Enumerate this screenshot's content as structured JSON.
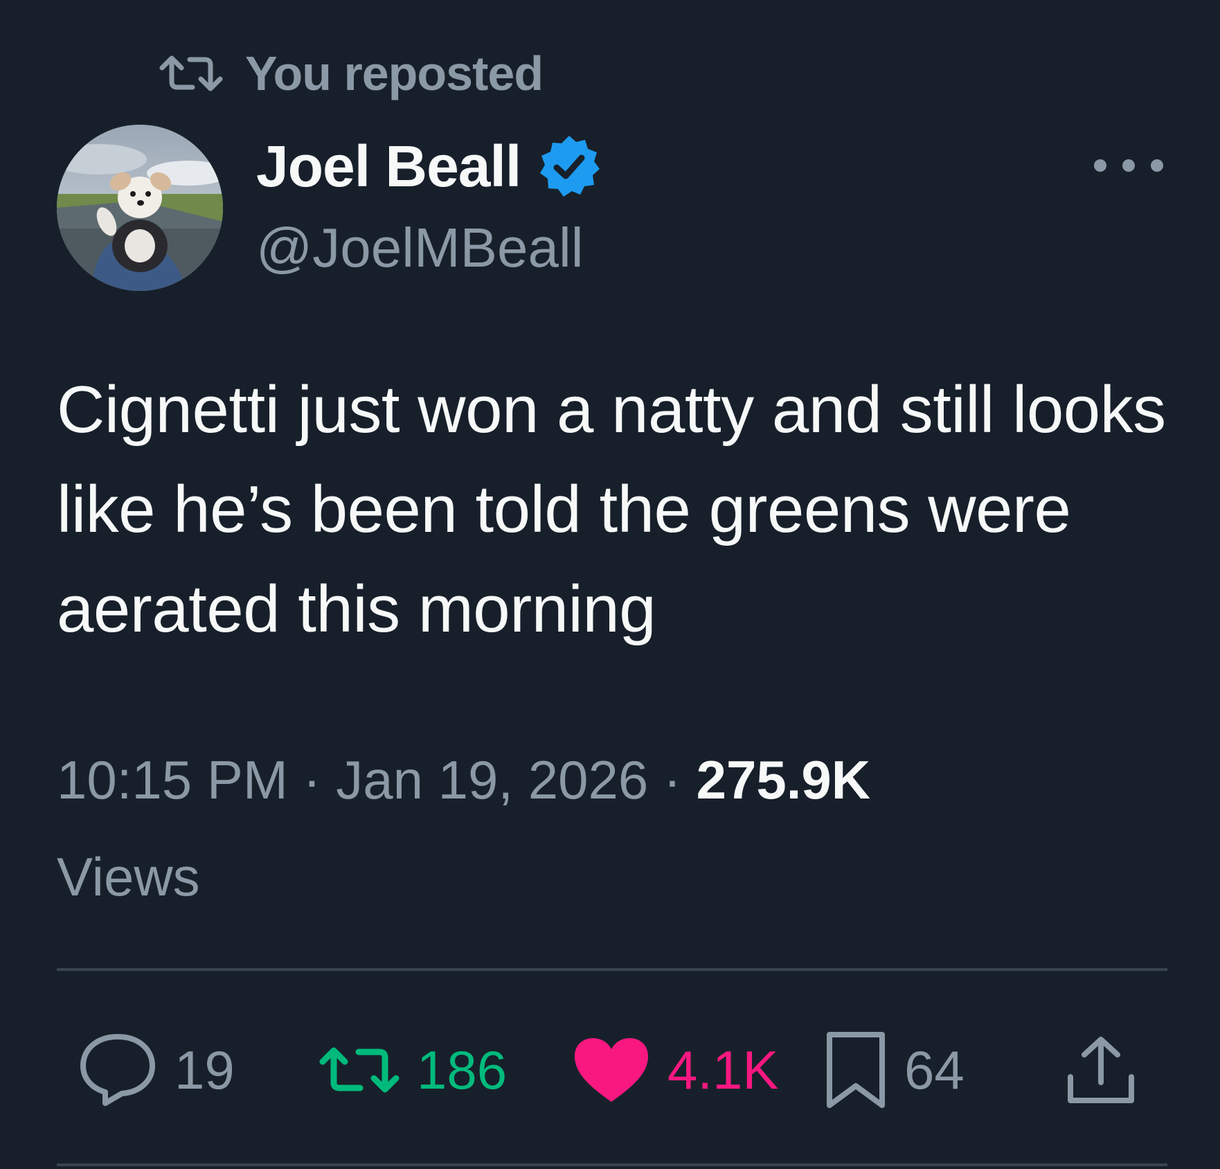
{
  "repost_context": {
    "icon": "retweet-icon",
    "label": "You reposted"
  },
  "author": {
    "avatar": "dog-avatar",
    "display_name": "Joel Beall",
    "verified": true,
    "verified_color": "#1d9bf0",
    "handle": "@JoelMBeall"
  },
  "more_icon": "more-options-icon",
  "tweet": {
    "text": "Cignetti just won a natty and still looks like he’s been told the greens were aerated this morning"
  },
  "meta": {
    "time": "10:15 PM",
    "separator": "·",
    "date": "Jan 19, 2026",
    "views_count": "275.9K",
    "views_label": "Views"
  },
  "actions": {
    "reply": {
      "icon": "reply-icon",
      "count": "19"
    },
    "retweet": {
      "icon": "retweet-icon",
      "count": "186",
      "color": "#00ba7c",
      "active": true
    },
    "like": {
      "icon": "heart-icon",
      "count": "4.1K",
      "color": "#f91880",
      "active": true
    },
    "bookmark": {
      "icon": "bookmark-icon",
      "count": "64"
    },
    "share": {
      "icon": "share-icon"
    }
  },
  "colors": {
    "background": "#17202a",
    "primary_text": "#f7f9f9",
    "secondary_text": "#8b98a5",
    "divider": "#38444d"
  }
}
